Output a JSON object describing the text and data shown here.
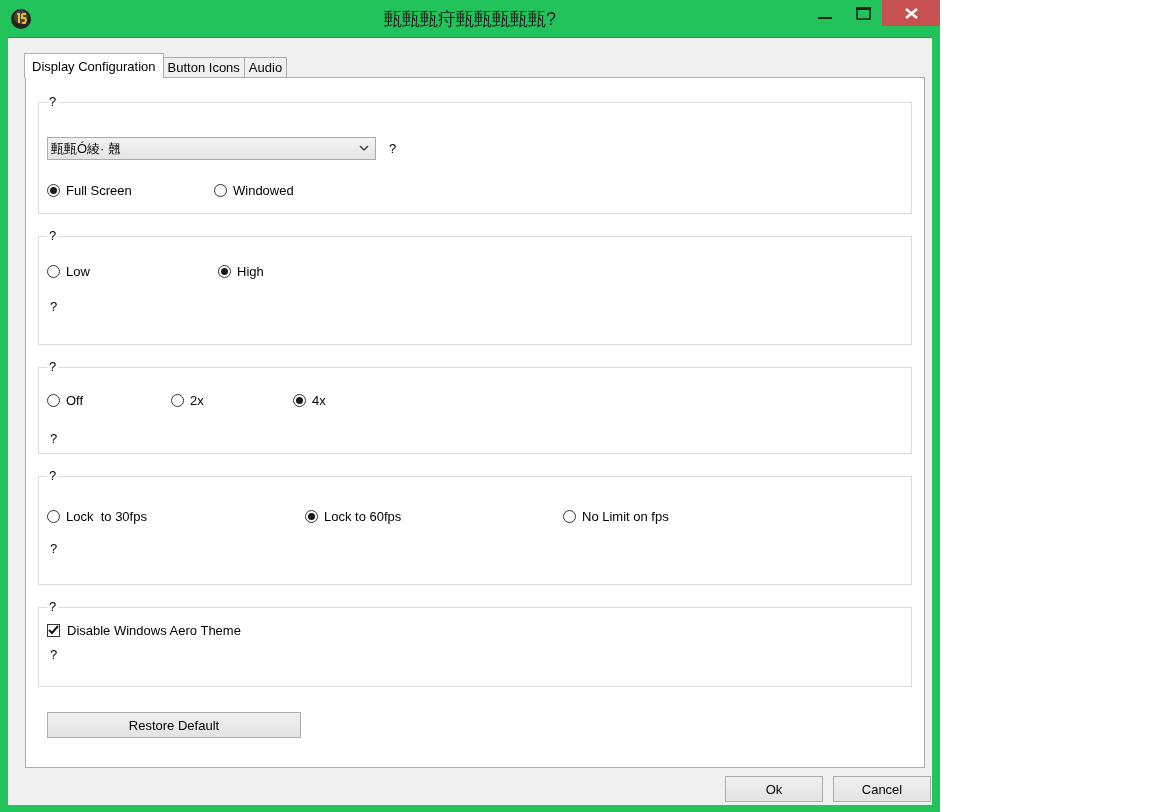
{
  "window": {
    "title": "甀甀甀疛甀甀甀甀甀?"
  },
  "tabs": [
    {
      "label": "Display Configuration",
      "selected": true
    },
    {
      "label": "Button Icons",
      "selected": false
    },
    {
      "label": "Audio",
      "selected": false
    }
  ],
  "groups": [
    {
      "legend": "?",
      "rows": [
        {
          "kind": "select",
          "value": "甀甀Ó綾· 翹",
          "hint": "?"
        },
        {
          "kind": "radios",
          "options": [
            {
              "label": "Full Screen",
              "selected": true
            },
            {
              "label": "Windowed",
              "selected": false
            }
          ]
        }
      ]
    },
    {
      "legend": "?",
      "rows": [
        {
          "kind": "radios",
          "options": [
            {
              "label": "Low",
              "selected": false
            },
            {
              "label": "High",
              "selected": true
            }
          ]
        },
        {
          "kind": "note",
          "text": "?"
        }
      ]
    },
    {
      "legend": "?",
      "rows": [
        {
          "kind": "radios",
          "options": [
            {
              "label": "Off",
              "selected": false
            },
            {
              "label": "2x",
              "selected": false
            },
            {
              "label": "4x",
              "selected": true
            }
          ]
        },
        {
          "kind": "note",
          "text": "?"
        }
      ]
    },
    {
      "legend": "?",
      "rows": [
        {
          "kind": "radios",
          "options": [
            {
              "label": "Lock  to 30fps",
              "selected": false
            },
            {
              "label": "Lock to 60fps",
              "selected": true
            },
            {
              "label": "No Limit on fps",
              "selected": false
            }
          ]
        },
        {
          "kind": "note",
          "text": "?"
        }
      ]
    },
    {
      "legend": "?",
      "rows": [
        {
          "kind": "checkbox",
          "label": "Disable Windows Aero Theme",
          "checked": true
        },
        {
          "kind": "note",
          "text": "?"
        }
      ]
    }
  ],
  "restore_button": "Restore Default",
  "buttons": [
    "Ok",
    "Cancel"
  ]
}
